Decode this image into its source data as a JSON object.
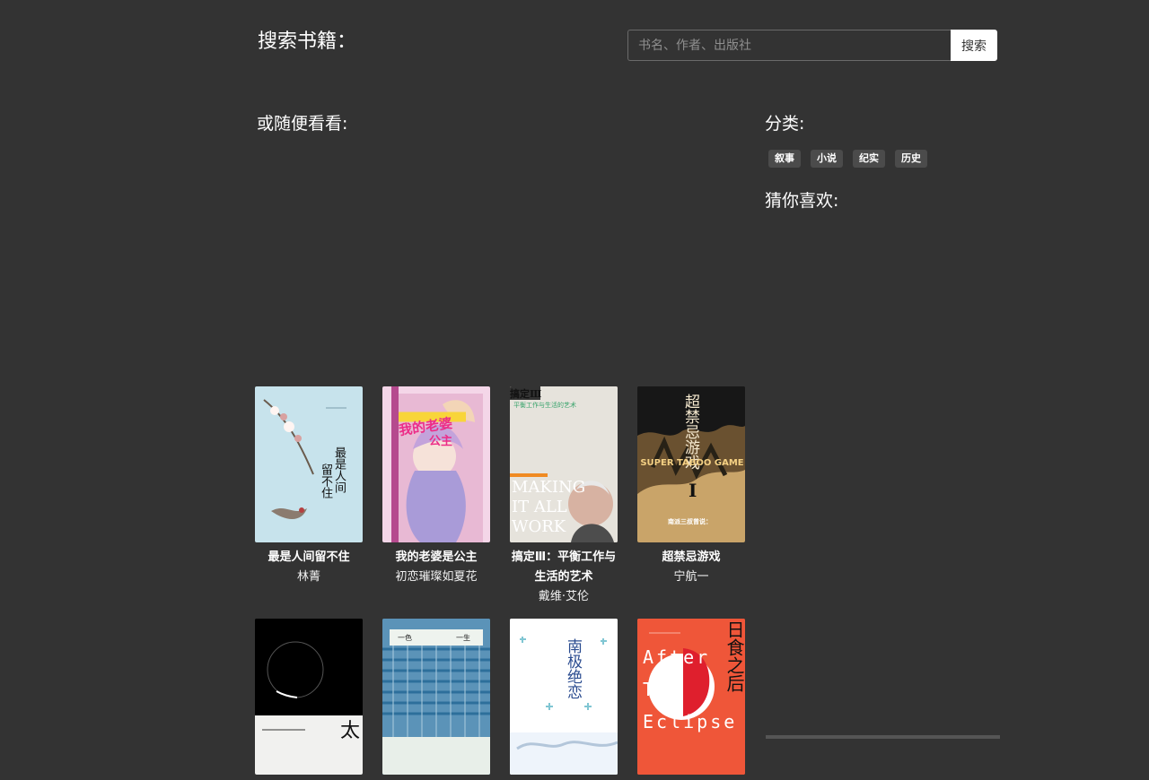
{
  "search": {
    "label": "搜索书籍：",
    "placeholder": "书名、作者、出版社",
    "button_label": "搜索"
  },
  "random_section": {
    "title": "或随便看看:"
  },
  "category_section": {
    "title": "分类:",
    "tags": [
      "叙事",
      "小说",
      "纪实",
      "历史"
    ]
  },
  "recommend_section": {
    "title": "猜你喜欢:"
  },
  "books": [
    {
      "title": "最是人间留不住",
      "author": "林菁",
      "cover_text": [
        "最是人间",
        "留不住"
      ]
    },
    {
      "title": "我的老婆是公主",
      "author": "初恋璀璨如夏花",
      "cover_text": [
        "我的老婆",
        "公主"
      ]
    },
    {
      "title": "搞定Ⅲ：平衡工作与生活的艺术",
      "author": "戴维·艾伦",
      "cover_text": [
        "搞定Ⅲ",
        "平衡工作与生活的艺术",
        "MAKING",
        "IT ALL",
        "WORK"
      ]
    },
    {
      "title": "超禁忌游戏",
      "author": "宁航一",
      "cover_text": [
        "超禁忌游戏",
        "SUPER TABOO GAME",
        "Ⅰ",
        "南派三叔曾说："
      ]
    },
    {
      "title": "",
      "author": "",
      "cover_text": [
        "太"
      ]
    },
    {
      "title": "",
      "author": "",
      "cover_text": [
        "一色",
        "一生"
      ]
    },
    {
      "title": "",
      "author": "",
      "cover_text": [
        "南极绝恋"
      ]
    },
    {
      "title": "",
      "author": "",
      "cover_text": [
        "日食之后",
        "After",
        "The",
        "Eclipse"
      ]
    }
  ]
}
